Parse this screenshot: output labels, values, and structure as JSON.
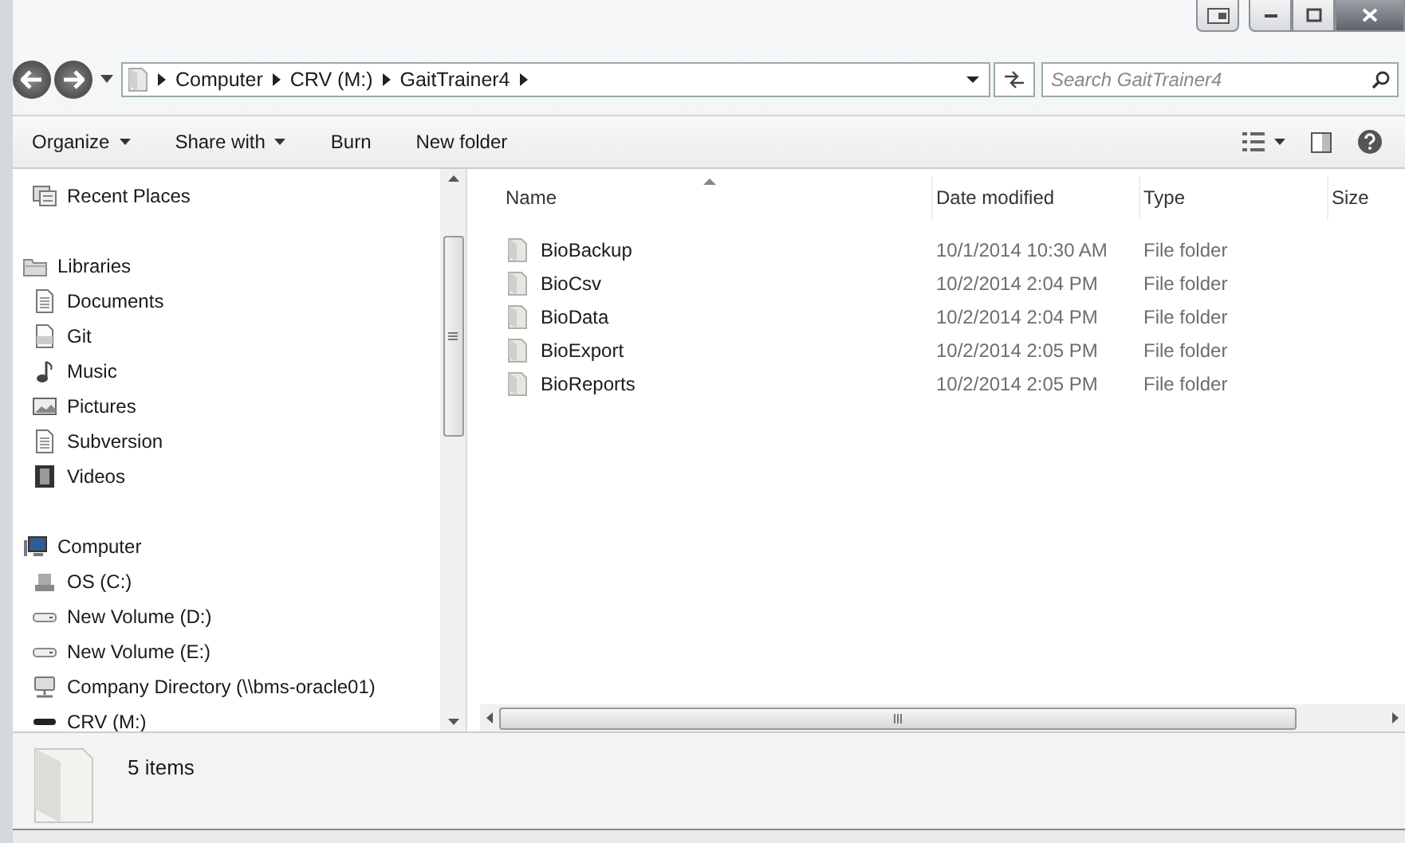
{
  "address_bar": {
    "path": [
      {
        "label": "Computer"
      },
      {
        "label": "CRV (M:)"
      },
      {
        "label": "GaitTrainer4"
      }
    ]
  },
  "search": {
    "placeholder": "Search GaitTrainer4"
  },
  "toolbar": {
    "buttons": [
      {
        "label": "Organize",
        "dropdown": true
      },
      {
        "label": "Share with",
        "dropdown": true
      },
      {
        "label": "Burn",
        "dropdown": false
      },
      {
        "label": "New folder",
        "dropdown": false
      }
    ]
  },
  "sidebar": {
    "items": [
      {
        "label": "Recent Places"
      },
      {
        "label": "Libraries",
        "children": [
          {
            "label": "Documents"
          },
          {
            "label": "Git"
          },
          {
            "label": "Music"
          },
          {
            "label": "Pictures"
          },
          {
            "label": "Subversion"
          },
          {
            "label": "Videos"
          }
        ]
      },
      {
        "label": "Computer",
        "children": [
          {
            "label": "OS (C:)"
          },
          {
            "label": "New Volume (D:)"
          },
          {
            "label": "New Volume (E:)"
          },
          {
            "label": "Company Directory (\\\\bms-oracle01)"
          },
          {
            "label": "CRV (M:)"
          }
        ]
      }
    ]
  },
  "table": {
    "columns": [
      {
        "label": "Name",
        "sorted": true
      },
      {
        "label": "Date modified",
        "sorted": false
      },
      {
        "label": "Type",
        "sorted": false
      },
      {
        "label": "Size",
        "sorted": false
      }
    ],
    "rows": [
      {
        "name": "BioBackup",
        "date": "10/1/2014 10:30 AM",
        "type": "File folder"
      },
      {
        "name": "BioCsv",
        "date": "10/2/2014 2:04 PM",
        "type": "File folder"
      },
      {
        "name": "BioData",
        "date": "10/2/2014 2:04 PM",
        "type": "File folder"
      },
      {
        "name": "BioExport",
        "date": "10/2/2014 2:05 PM",
        "type": "File folder"
      },
      {
        "name": "BioReports",
        "date": "10/2/2014 2:05 PM",
        "type": "File folder"
      }
    ]
  },
  "status_bar": {
    "count": "5 items"
  }
}
